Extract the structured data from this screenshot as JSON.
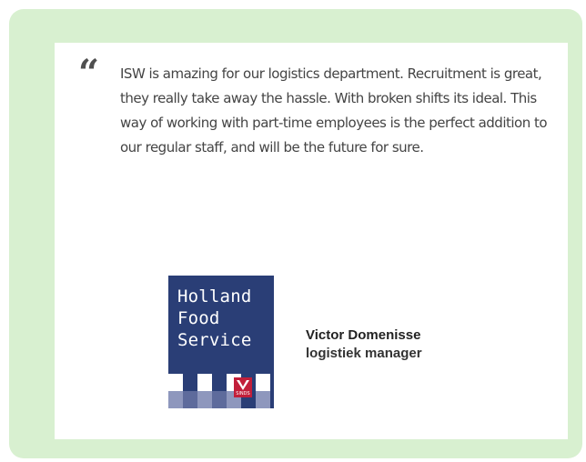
{
  "testimonial": {
    "quote_mark": "“",
    "text": "ISW is amazing for our logistics department. Recruitment is great, they really take away the hassle. With broken shifts its ideal. This way of working with part-time employees is the perfect addition to our regular staff, and will be the future for sure.",
    "logo": {
      "line1": "Holland",
      "line2": "Food",
      "line3": "Service",
      "badge_label": "SINDS"
    },
    "author_name": "Victor Domenisse",
    "author_role": "logistiek manager"
  },
  "colors": {
    "panel_background": "#d8f0d0",
    "logo_blue": "#2a3e76",
    "badge_red": "#c21f3a"
  }
}
